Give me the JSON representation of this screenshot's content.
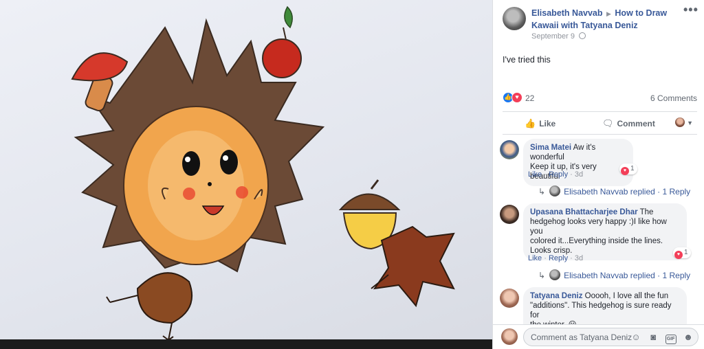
{
  "photo": {
    "description_icon": "artwork-image"
  },
  "post": {
    "author": "Elisabeth Navvab",
    "separator_icon": "right-arrow-icon",
    "group": "How to Draw Kawaii with Tatyana Deniz",
    "date": "September 9",
    "privacy_icon": "globe-icon",
    "more_label": "•••",
    "text": "I've tried this",
    "reaction_count": "22",
    "comments_count": "6 Comments"
  },
  "actions": {
    "like": "Like",
    "comment": "Comment"
  },
  "comments": [
    {
      "name": "Sima Matei",
      "text_line1": " Aw it's wonderful",
      "text_line2": "Keep it up, it's very beautiful",
      "like": "Like",
      "reply": "Reply",
      "time": "3d",
      "hearts": "1",
      "reply_author": "Elisabeth Navvab replied",
      "reply_count": "1 Reply"
    },
    {
      "name": "Upasana Bhattacharjee Dhar",
      "text_line1": " The",
      "text_line2": "hedgehog looks very happy :)I like how you",
      "text_line3": "colored it...Everything inside the lines.",
      "text_line4": "Looks crisp.",
      "like": "Like",
      "reply": "Reply",
      "time": "3d",
      "hearts": "1",
      "reply_author": "Elisabeth Navvab replied",
      "reply_count": "1 Reply"
    },
    {
      "name": "Tatyana Deniz",
      "text_line1": " Ooooh, I love all the fun",
      "text_line2": "\"additions\". This hedgehog is sure ready for",
      "text_line3": "the winter. ",
      "emoji": "😀"
    }
  ],
  "composer": {
    "placeholder": "Comment as Tatyana Deniz",
    "gif_label": "GIF"
  },
  "colors": {
    "link_blue": "#385898",
    "like_blue": "#1877f2",
    "love_red": "#f33e58",
    "bubble_gray": "#f2f3f5"
  }
}
